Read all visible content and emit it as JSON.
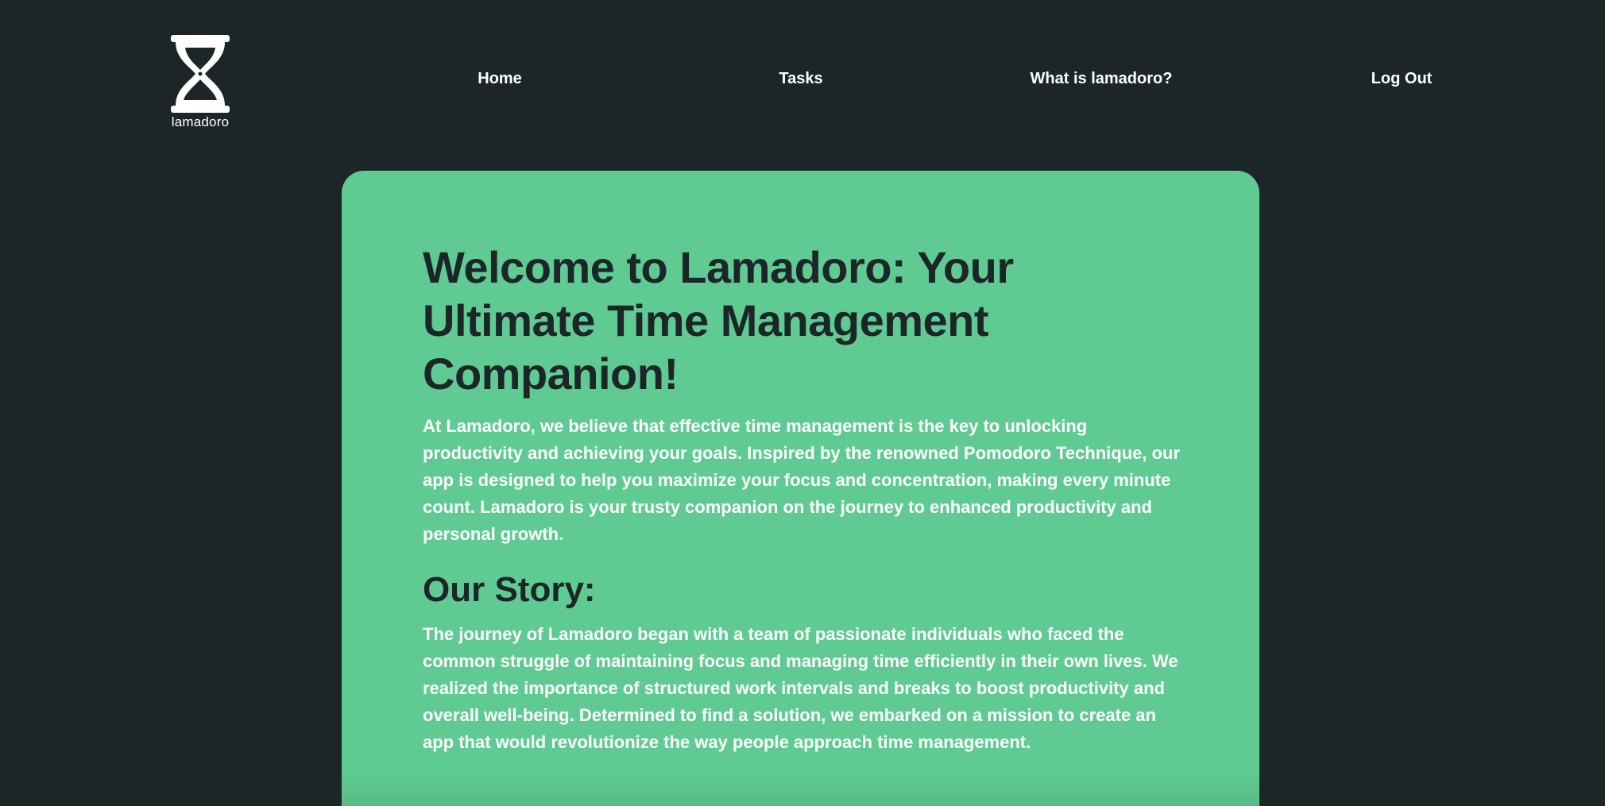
{
  "brand": {
    "name": "lamadoro",
    "icon": "hourglass-icon"
  },
  "nav": {
    "items": [
      {
        "label": "Home"
      },
      {
        "label": "Tasks"
      },
      {
        "label": "What is lamadoro?"
      },
      {
        "label": "Log Out"
      }
    ]
  },
  "content": {
    "title": "Welcome to Lamadoro: Your Ultimate Time Management Companion!",
    "intro": "At Lamadoro, we believe that effective time management is the key to unlocking productivity and achieving your goals. Inspired by the renowned Pomodoro Technique, our app is designed to help you maximize your focus and concentration, making every minute count. Lamadoro is your trusty companion on the journey to enhanced productivity and personal growth.",
    "story_heading": "Our Story:",
    "story": "The journey of Lamadoro began with a team of passionate individuals who faced the common struggle of maintaining focus and managing time efficiently in their own lives. We realized the importance of structured work intervals and breaks to boost productivity and overall well-being. Determined to find a solution, we embarked on a mission to create an app that would revolutionize the way people approach time management."
  },
  "colors": {
    "background": "#1c2629",
    "card": "#5fca91",
    "heading_text": "#1c2629",
    "body_text": "#ffffff"
  }
}
